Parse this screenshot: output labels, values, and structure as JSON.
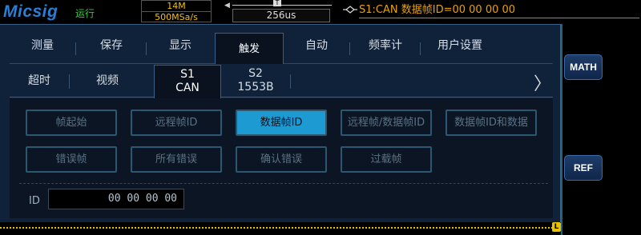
{
  "status": {
    "brand": "Micsig",
    "run_state": "运行",
    "memory_depth": "14M",
    "sample_rate": "500MSa/s",
    "timebase_marker": "T",
    "timebase": "256us",
    "trigger_readout": "S1:CAN 数据帧ID=00 00 00 00"
  },
  "side_buttons": {
    "math": "MATH",
    "ref": "REF"
  },
  "menu_tabs": [
    {
      "label": "测量"
    },
    {
      "label": "保存"
    },
    {
      "label": "显示"
    },
    {
      "label": "触发",
      "active": true
    },
    {
      "label": "自动"
    },
    {
      "label": "频率计"
    },
    {
      "label": "用户设置"
    }
  ],
  "trigger_tabs": [
    {
      "label": "超时"
    },
    {
      "label": "视频"
    },
    {
      "line1": "S1",
      "line2": "CAN",
      "active": true
    },
    {
      "line1": "S2",
      "line2": "1553B"
    }
  ],
  "options": [
    {
      "label": "帧起始"
    },
    {
      "label": "远程帧ID"
    },
    {
      "label": "数据帧ID",
      "selected": true
    },
    {
      "label": "远程帧/数据帧ID"
    },
    {
      "label": "数据帧ID和数据"
    },
    {
      "label": "错误帧"
    },
    {
      "label": "所有错误"
    },
    {
      "label": "确认错误"
    },
    {
      "label": "过载帧"
    }
  ],
  "id_field": {
    "label": "ID",
    "value": "00 00 00 00"
  },
  "colors": {
    "accent": "#1e9ad2",
    "panel": "#10223a",
    "trigger_text": "#e8a200",
    "run": "#2ecc40"
  },
  "icons": {
    "next_page": "chevron-right-icon",
    "trigger_edge": "trigger-diamond-icon",
    "level_marker": "level-marker-icon"
  },
  "level_marker_label": "L"
}
